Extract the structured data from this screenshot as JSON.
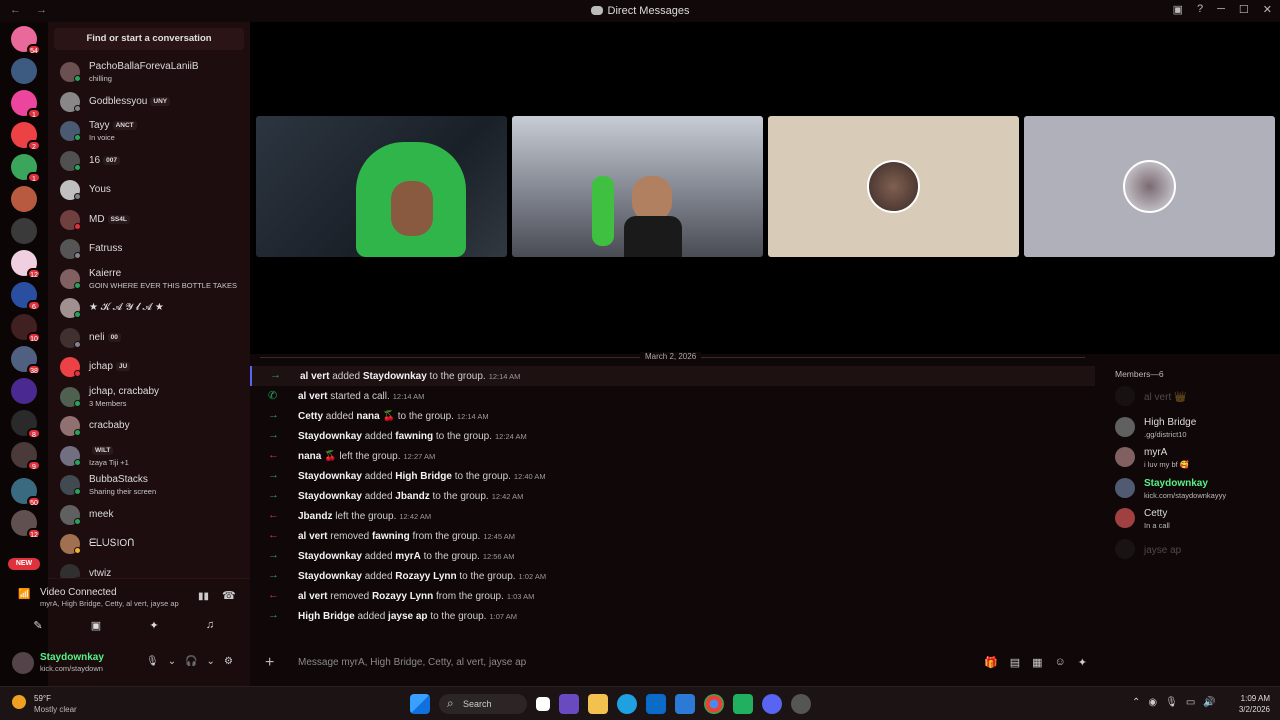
{
  "window": {
    "title": "Direct Messages",
    "nav": "← →",
    "controls": [
      "▣",
      "?",
      "─",
      "☐",
      "✕"
    ]
  },
  "servers": {
    "badges": [
      "54",
      "1",
      "2",
      "1",
      "12",
      "6",
      "10",
      "38",
      "8",
      "9",
      "50",
      "12"
    ],
    "new_badge": "NEW"
  },
  "dm_search": {
    "label": "Find or start a conversation"
  },
  "dms": [
    {
      "name": "PachoBallaForevaLaniiB",
      "tag": "",
      "sub": "chilling"
    },
    {
      "name": "Godblessyou",
      "tag": "UNY",
      "sub": ""
    },
    {
      "name": "Tayy",
      "tag": "ANCT",
      "sub": "In voice"
    },
    {
      "name": "16",
      "tag": "007",
      "sub": ""
    },
    {
      "name": "Yous",
      "tag": "",
      "sub": ""
    },
    {
      "name": "MD",
      "tag": "SS4L",
      "sub": ""
    },
    {
      "name": "Fatruss",
      "tag": "",
      "sub": ""
    },
    {
      "name": "Kaierre",
      "tag": "",
      "sub": "GOIN WHERE EVER THIS BOTTLE TAKES"
    },
    {
      "name": "★ 𝓚 𝓐 𝓨 𝓵 𝓐 ★",
      "tag": "",
      "sub": ""
    },
    {
      "name": "neli",
      "tag": "00",
      "sub": ""
    },
    {
      "name": "jchap",
      "tag": "JU",
      "sub": ""
    },
    {
      "name": "jchap, cracbaby",
      "tag": "",
      "sub": "3 Members"
    },
    {
      "name": "cracbaby",
      "tag": "",
      "sub": ""
    },
    {
      "name": "",
      "tag": "WILT",
      "sub": "Izaya Tiji +1"
    },
    {
      "name": "BubbaStacks",
      "tag": "",
      "sub": "Sharing their screen"
    },
    {
      "name": "meek",
      "tag": "",
      "sub": ""
    },
    {
      "name": "ᗴᒪᑌՏIOᑎ",
      "tag": "",
      "sub": ""
    },
    {
      "name": "vtwiz",
      "tag": "",
      "sub": ""
    }
  ],
  "voice": {
    "status": "Video Connected",
    "members": "myrA, High Bridge, Cetty, al vert, jayse ap"
  },
  "user": {
    "name": "Staydownkay",
    "status": "kick.com/staydown"
  },
  "call": {
    "tiles": 4
  },
  "date_divider": "March 2, 2026",
  "messages": [
    {
      "dir": "in",
      "a": "al vert",
      "verb": "added",
      "b": "Staydownkay",
      "rest": "to the group.",
      "time": "12:14 AM"
    },
    {
      "dir": "call",
      "a": "al vert",
      "verb": "started a call.",
      "b": "",
      "rest": "",
      "time": "12:14 AM"
    },
    {
      "dir": "in",
      "a": "Cetty",
      "verb": "added",
      "b": "nana 🍒",
      "rest": "to the group.",
      "time": "12:14 AM"
    },
    {
      "dir": "in",
      "a": "Staydownkay",
      "verb": "added",
      "b": "fawning",
      "rest": "to the group.",
      "time": "12:24 AM"
    },
    {
      "dir": "out",
      "a": "nana 🍒",
      "verb": "left the group.",
      "b": "",
      "rest": "",
      "time": "12:27 AM"
    },
    {
      "dir": "in",
      "a": "Staydownkay",
      "verb": "added",
      "b": "High Bridge",
      "rest": "to the group.",
      "time": "12:40 AM"
    },
    {
      "dir": "in",
      "a": "Staydownkay",
      "verb": "added",
      "b": "Jbandz",
      "rest": "to the group.",
      "time": "12:42 AM"
    },
    {
      "dir": "out",
      "a": "Jbandz",
      "verb": "left the group.",
      "b": "",
      "rest": "",
      "time": "12:42 AM"
    },
    {
      "dir": "out",
      "a": "al vert",
      "verb": "removed",
      "b": "fawning",
      "rest": "from the group.",
      "time": "12:45 AM"
    },
    {
      "dir": "in",
      "a": "Staydownkay",
      "verb": "added",
      "b": "myrA",
      "rest": "to the group.",
      "time": "12:56 AM"
    },
    {
      "dir": "in",
      "a": "Staydownkay",
      "verb": "added",
      "b": "Rozayy Lynn",
      "rest": "to the group.",
      "time": "1:02 AM"
    },
    {
      "dir": "out",
      "a": "al vert",
      "verb": "removed",
      "b": "Rozayy Lynn",
      "rest": "from the group.",
      "time": "1:03 AM"
    },
    {
      "dir": "in",
      "a": "High Bridge",
      "verb": "added",
      "b": "jayse ap",
      "rest": "to the group.",
      "time": "1:07 AM"
    }
  ],
  "members_panel": {
    "header": "Members—6",
    "members": [
      {
        "name": "al vert 👑",
        "sub": "",
        "dim": true
      },
      {
        "name": "High Bridge",
        "sub": ".gg/district10",
        "dim": false
      },
      {
        "name": "myrA",
        "sub": "i luv my bf 🥰",
        "dim": false
      },
      {
        "name": "Staydownkay",
        "sub": "kick.com/staydownkayyy",
        "dim": false
      },
      {
        "name": "Cetty",
        "sub": "In a call",
        "dim": false
      },
      {
        "name": "jayse ap",
        "sub": "",
        "dim": true
      }
    ]
  },
  "composer": {
    "placeholder": "Message myrA, High Bridge, Cetty, al vert, jayse ap"
  },
  "taskbar": {
    "temp": "59°F",
    "condition": "Mostly clear",
    "search": "Search",
    "time": "1:09 AM",
    "date": "3/2/2026"
  },
  "colors": {
    "join": "#23a55a",
    "leave": "#e0323c",
    "accent": "#5865f2",
    "online": "#23a55a"
  }
}
